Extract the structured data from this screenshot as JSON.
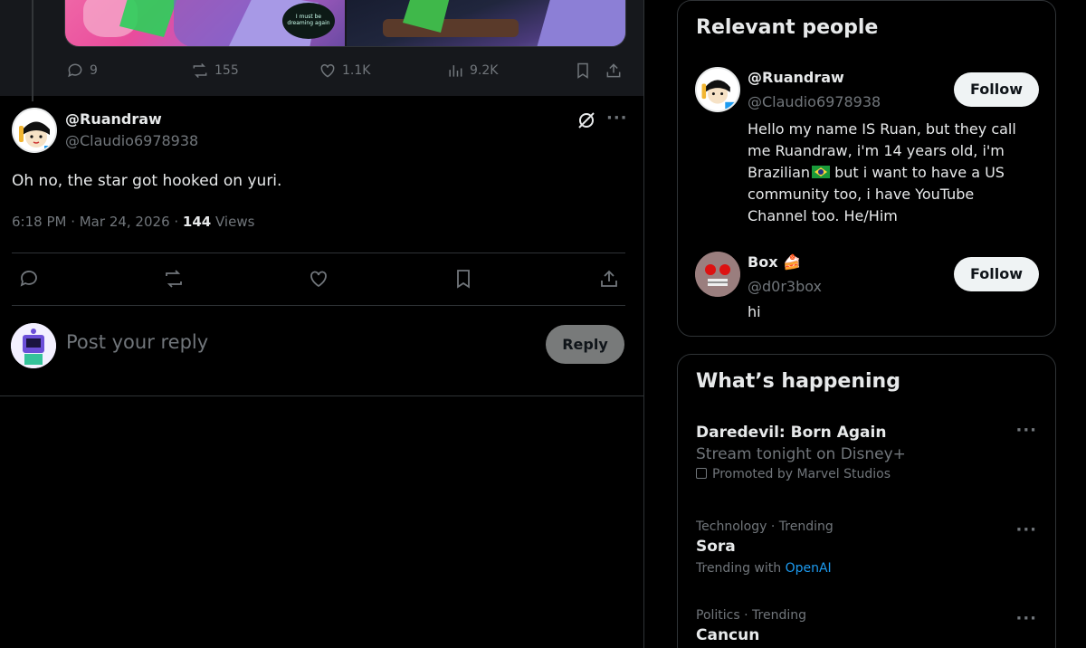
{
  "previous_post": {
    "media_caption": "I must be dreaming again",
    "actions": [
      {
        "icon": "reply-icon",
        "count": "9"
      },
      {
        "icon": "repost-icon",
        "count": "155"
      },
      {
        "icon": "like-icon",
        "count": "1.1K"
      },
      {
        "icon": "views-icon",
        "count": "9.2K"
      },
      {
        "icon": "bookmark-icon",
        "count": ""
      },
      {
        "icon": "share-icon",
        "count": ""
      }
    ]
  },
  "post": {
    "display_name": "@Ruandraw",
    "handle": "@Claudio6978938",
    "text": "Oh no, the star got hooked on yuri.",
    "time": "6:18 PM · Mar 24, 2026 · ",
    "views_count": "144",
    "views_label": " Views"
  },
  "reply_box": {
    "placeholder": "Post your reply",
    "button_label": "Reply"
  },
  "relevant_people": {
    "title": "Relevant people",
    "people": [
      {
        "display_name": "@Ruandraw",
        "handle": "@Claudio6978938",
        "bio_before_flag": "Hello my name IS Ruan, but they call me Ruandraw, i'm 14 years old, i'm Brazilian",
        "bio_after_flag": " but i want to have a US community too, i have YouTube Channel too. He/Him",
        "follow_label": "Follow"
      },
      {
        "display_name": "Box",
        "emoji": "🍰",
        "handle": "@d0r3box",
        "bio": "hi",
        "follow_label": "Follow"
      }
    ]
  },
  "whats_happening": {
    "title": "What’s happening",
    "items": [
      {
        "main": "Daredevil: Born Again",
        "sub": "Stream tonight on Disney+",
        "promo": "Promoted by Marvel Studios"
      },
      {
        "context": "Technology · Trending",
        "main": "Sora",
        "trending_with": "Trending with ",
        "link": "OpenAI"
      },
      {
        "context": "Politics · Trending",
        "main": "Cancun"
      }
    ],
    "more_label": "···"
  },
  "colors": {
    "background": "#000000",
    "text_primary": "#e7e9ea",
    "text_secondary": "#71767b",
    "border": "#2f3336",
    "link": "#1d9bf0"
  }
}
